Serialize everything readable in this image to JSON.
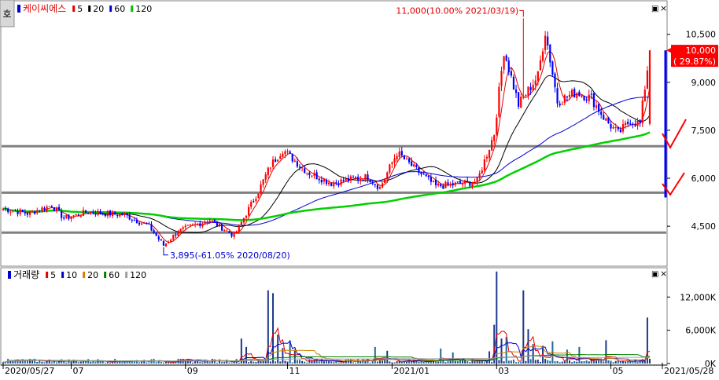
{
  "corner_glyph": "호",
  "window_buttons": {
    "restore": "▣",
    "close": "×"
  },
  "price_panel": {
    "stock_name": "케이씨에스",
    "ma_legend": [
      {
        "label": "5",
        "color": "#e00000"
      },
      {
        "label": "20",
        "color": "#000000"
      },
      {
        "label": "60",
        "color": "#0000d0"
      },
      {
        "label": "120",
        "color": "#00c000"
      }
    ]
  },
  "volume_panel": {
    "title": "거래량",
    "ma_legend": [
      {
        "label": "5",
        "color": "#e00000"
      },
      {
        "label": "10",
        "color": "#0000d0"
      },
      {
        "label": "20",
        "color": "#d08000"
      },
      {
        "label": "60",
        "color": "#008000"
      },
      {
        "label": "120",
        "color": "#a0a0a0"
      }
    ]
  },
  "chart_data": [
    {
      "type": "candlestick",
      "series_labels": [
        "5",
        "20",
        "60",
        "120"
      ],
      "yticks": [
        "10,500",
        "9,000",
        "7,500",
        "6,000",
        "4,500"
      ],
      "ytick_values": [
        10500,
        9000,
        7500,
        6000,
        4500
      ],
      "ylim": [
        3300,
        11500
      ],
      "current_price": "10,000",
      "current_change": "( 29.87%)",
      "current_value": 10000,
      "high_annotation": "11,000(10.00% 2021/03/19)",
      "high_value": 11000,
      "low_annotation": "3,895(-61.05% 2020/08/20)",
      "low_value": 3895,
      "horizontal_lines": [
        7000,
        5550,
        4300
      ],
      "price_anchors": [
        [
          0,
          5050
        ],
        [
          10,
          4900
        ],
        [
          20,
          5150
        ],
        [
          25,
          4750
        ],
        [
          35,
          4950
        ],
        [
          50,
          4850
        ],
        [
          60,
          4500
        ],
        [
          66,
          3895
        ],
        [
          72,
          4350
        ],
        [
          85,
          4700
        ],
        [
          95,
          4200
        ],
        [
          105,
          5600
        ],
        [
          110,
          6400
        ],
        [
          115,
          6900
        ],
        [
          125,
          6200
        ],
        [
          135,
          5850
        ],
        [
          150,
          6050
        ],
        [
          155,
          5700
        ],
        [
          162,
          6800
        ],
        [
          170,
          6250
        ],
        [
          178,
          5750
        ],
        [
          185,
          5800
        ],
        [
          195,
          5900
        ],
        [
          202,
          7400
        ],
        [
          206,
          10000
        ],
        [
          212,
          8300
        ],
        [
          220,
          9200
        ],
        [
          223,
          10600
        ],
        [
          228,
          8400
        ],
        [
          236,
          8700
        ],
        [
          242,
          8500
        ],
        [
          248,
          7800
        ],
        [
          253,
          7400
        ],
        [
          258,
          7800
        ],
        [
          262,
          7700
        ],
        [
          266,
          10000
        ]
      ]
    },
    {
      "type": "bar",
      "yticks": [
        "12,000K",
        "6,000K",
        "0K"
      ],
      "ytick_values": [
        12000,
        6000,
        0
      ],
      "ylim": [
        0,
        17000
      ],
      "xticks": [
        "2020/05/27",
        "07",
        "09",
        "11",
        "2021/01",
        "03",
        "05",
        "2021/05/28"
      ],
      "xtick_index": [
        0,
        28,
        75,
        117,
        160,
        203,
        250,
        266
      ],
      "volume_spikes": [
        [
          98,
          4500
        ],
        [
          100,
          3000
        ],
        [
          109,
          13200
        ],
        [
          111,
          12700
        ],
        [
          113,
          5200
        ],
        [
          115,
          2800
        ],
        [
          118,
          4200
        ],
        [
          120,
          2500
        ],
        [
          153,
          3000
        ],
        [
          158,
          2300
        ],
        [
          180,
          2700
        ],
        [
          185,
          2000
        ],
        [
          200,
          2200
        ],
        [
          202,
          7000
        ],
        [
          203,
          16600
        ],
        [
          205,
          4500
        ],
        [
          207,
          4800
        ],
        [
          214,
          13200
        ],
        [
          216,
          6200
        ],
        [
          218,
          3500
        ],
        [
          222,
          3200
        ],
        [
          226,
          4000
        ],
        [
          232,
          2500
        ],
        [
          237,
          3000
        ],
        [
          248,
          4200
        ],
        [
          265,
          8300
        ]
      ]
    }
  ]
}
